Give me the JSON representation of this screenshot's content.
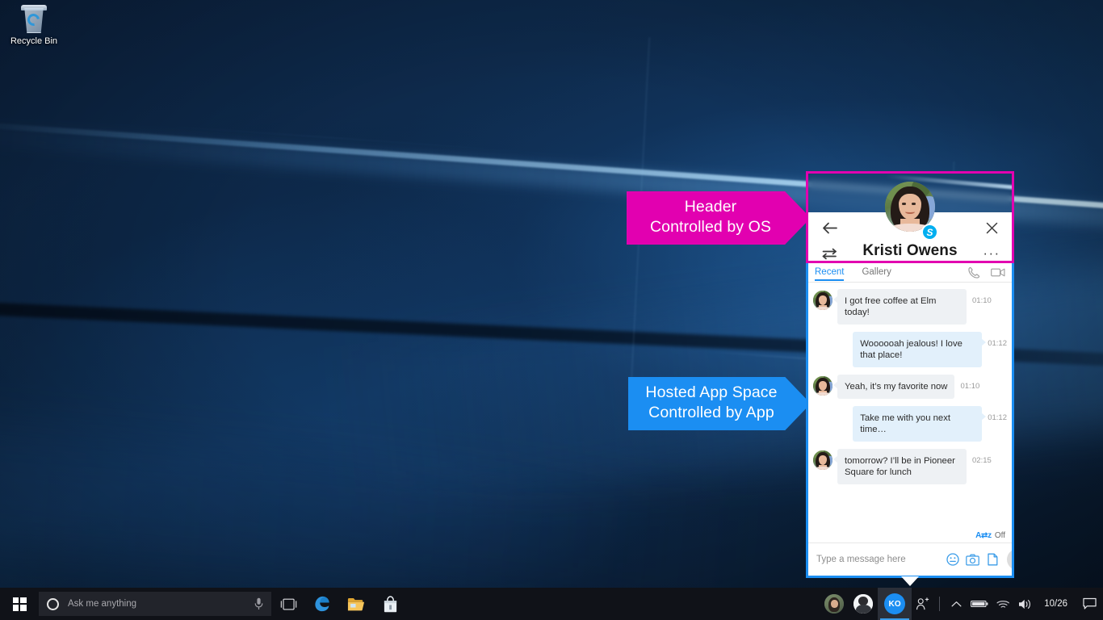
{
  "desktop": {
    "icons": [
      {
        "name": "recycle-bin",
        "label": "Recycle Bin"
      }
    ]
  },
  "callouts": [
    {
      "id": "header",
      "text": "Header\nControlled by OS",
      "color": "#e200b0"
    },
    {
      "id": "app",
      "text": "Hosted App Space\nControlled by App",
      "color": "#1b8ef2"
    }
  ],
  "app": {
    "header": {
      "title": "Kristi Owens",
      "back_icon": "back-arrow-icon",
      "swap_icon": "swap-transfer-icon",
      "close_icon": "close-icon",
      "more_label": "···",
      "badge": "S",
      "avatar_alt": "Kristi Owens profile photo"
    },
    "tabs": [
      {
        "label": "Recent",
        "active": true
      },
      {
        "label": "Gallery",
        "active": false
      }
    ],
    "tab_actions": [
      {
        "name": "audio-call-icon"
      },
      {
        "name": "video-call-icon"
      }
    ],
    "messages": [
      {
        "dir": "in",
        "text": "I got free coffee at Elm today!",
        "time": "01:10"
      },
      {
        "dir": "out",
        "text": "Woooooah jealous! I love that place!",
        "time": "01:12"
      },
      {
        "dir": "in",
        "text": "Yeah, it’s my favorite now",
        "time": "01:10"
      },
      {
        "dir": "out",
        "text": "Take me with you next time…",
        "time": "01:12"
      },
      {
        "dir": "in",
        "text": "tomorrow? I’ll be in Pioneer Square for lunch",
        "time": "02:15"
      }
    ],
    "translator": {
      "icon": "translator-icon",
      "label": "Off"
    },
    "composer": {
      "placeholder": "Type a message here",
      "value": "",
      "icons": [
        {
          "name": "emoji-icon"
        },
        {
          "name": "photo-icon"
        },
        {
          "name": "file-attachment-icon"
        }
      ],
      "send_label": "send-icon"
    }
  },
  "taskbar": {
    "start": "start-button",
    "search": {
      "placeholder": "Ask me anything",
      "value": "",
      "cortana_icon": "cortana-circle-icon",
      "mic_icon": "microphone-icon"
    },
    "pinned": [
      {
        "name": "task-view-icon"
      },
      {
        "name": "edge-browser-icon"
      },
      {
        "name": "file-explorer-icon"
      },
      {
        "name": "microsoft-store-icon"
      }
    ],
    "tray": {
      "people": [
        {
          "name": "contact-avatar-1"
        },
        {
          "name": "contact-avatar-2"
        },
        {
          "name": "contact-avatar-kristi",
          "initials": "KO"
        }
      ],
      "my-people": {
        "name": "my-people-icon"
      },
      "items": [
        {
          "name": "show-hidden-icons-chevron"
        },
        {
          "name": "battery-icon"
        },
        {
          "name": "wifi-icon"
        },
        {
          "name": "volume-icon"
        }
      ],
      "clock": "10/26",
      "action_center": "action-center-icon"
    }
  }
}
